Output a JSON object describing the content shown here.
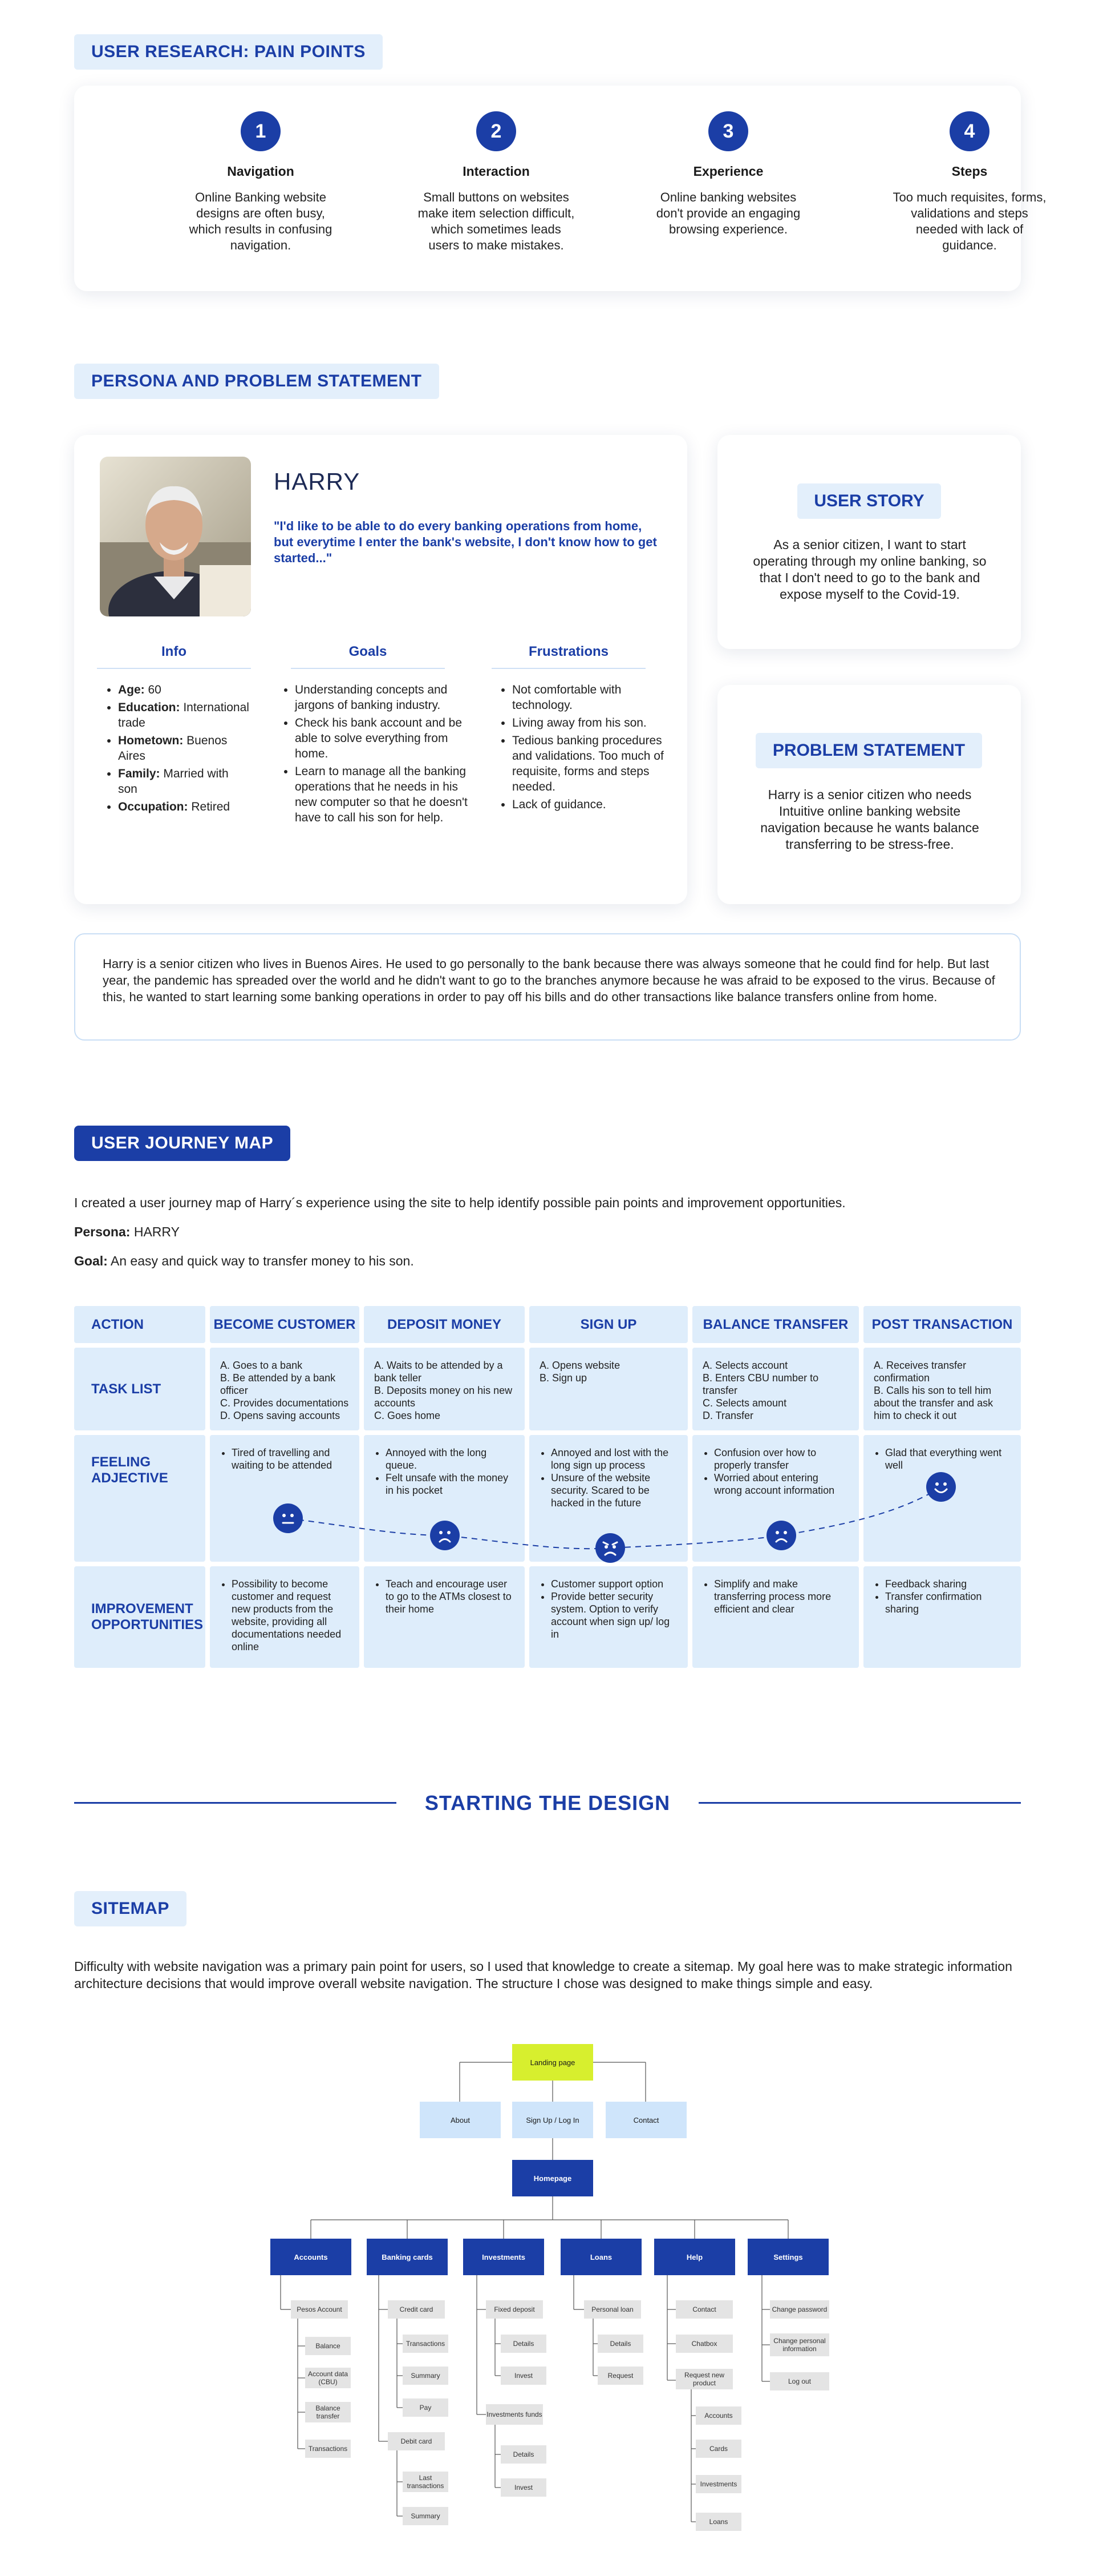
{
  "pain_points": {
    "heading": "USER RESEARCH: PAIN POINTS",
    "items": [
      {
        "num": "1",
        "title": "Navigation",
        "text": "Online Banking website designs are often busy, which results in confusing navigation."
      },
      {
        "num": "2",
        "title": "Interaction",
        "text": "Small buttons on websites make item selection difficult, which sometimes leads users to make mistakes."
      },
      {
        "num": "3",
        "title": "Experience",
        "text": "Online banking websites don't provide an engaging browsing experience."
      },
      {
        "num": "4",
        "title": "Steps",
        "text": "Too much requisites, forms, validations and steps needed with lack of guidance."
      }
    ]
  },
  "persona": {
    "heading": "PERSONA AND PROBLEM STATEMENT",
    "name": "HARRY",
    "quote": "\"I'd like to be able to do every banking operations from home, but everytime I enter the bank's website, I don't know how to get started...\"",
    "info_title": "Info",
    "info": [
      {
        "label": "Age:",
        "value": " 60"
      },
      {
        "label": "Education:",
        "value": " International trade"
      },
      {
        "label": "Hometown:",
        "value": " Buenos Aires"
      },
      {
        "label": "Family:",
        "value": " Married with son"
      },
      {
        "label": "Occupation:",
        "value": " Retired"
      }
    ],
    "goals_title": "Goals",
    "goals": [
      "Understanding concepts and jargons of banking industry.",
      "Check his bank account and be able to solve everything from home.",
      "Learn to manage all the banking operations that he needs in his new computer so that he doesn't have to call his son for help."
    ],
    "frustrations_title": "Frustrations",
    "frustrations": [
      "Not comfortable with technology.",
      "Living away from his son.",
      "Tedious banking procedures and validations. Too much of requisite, forms and steps needed.",
      "Lack of guidance."
    ],
    "user_story_title": "USER STORY",
    "user_story": "As a senior citizen, I want to start operating through my online banking, so that I don't need to go to the bank and expose myself to the Covid-19.",
    "problem_title": "PROBLEM STATEMENT",
    "problem": "Harry is a senior citizen who needs Intuitive online banking website navigation because he wants balance transferring to be stress-free.",
    "summary": "Harry is a senior citizen who lives in Buenos Aires. He used to go personally to the bank because there was always someone that he could find for help. But last year, the pandemic has spreaded over the world and he didn't want to go to the branches anymore because he was afraid to be exposed to the virus. Because of this, he wanted to start learning some banking operations in order to pay off his bills and do other transactions like balance transfers online from home."
  },
  "journey": {
    "heading": "USER JOURNEY MAP",
    "intro": "I created a user journey map of Harry´s experience using the site to help identify possible pain points and improvement opportunities.",
    "persona_label": "Persona:",
    "persona_value": " HARRY",
    "goal_label": "Goal:",
    "goal_value": " An easy and quick way to transfer money to his son.",
    "action_label": "ACTION",
    "columns": [
      "BECOME CUSTOMER",
      "DEPOSIT MONEY",
      "SIGN UP",
      "BALANCE TRANSFER",
      "POST TRANSACTION"
    ],
    "row_labels": [
      "TASK LIST",
      "FEELING ADJECTIVE",
      "IMPROVEMENT OPPORTUNITIES"
    ],
    "tasks": [
      [
        "A. Goes to a bank",
        "B. Be attended by a bank officer",
        "C. Provides documentations",
        "D. Opens saving accounts"
      ],
      [
        "A. Waits to be attended by a bank teller",
        "B. Deposits money on his new accounts",
        "C. Goes home"
      ],
      [
        "A. Opens website",
        "B. Sign up"
      ],
      [
        "A. Selects account",
        "B. Enters CBU number to transfer",
        "C. Selects amount",
        "D. Transfer"
      ],
      [
        "A. Receives transfer confirmation",
        "B. Calls his son to tell him about the transfer and ask him to check it out"
      ]
    ],
    "feelings": [
      [
        "Tired of travelling and waiting to be attended"
      ],
      [
        "Annoyed with the long queue.",
        "Felt unsafe with the money in his pocket"
      ],
      [
        "Annoyed and lost with the long sign up process",
        "Unsure of the website security. Scared to be hacked in the future"
      ],
      [
        "Confusion over how to properly transfer",
        "Worried about entering wrong account information"
      ],
      [
        "Glad that everything went well"
      ]
    ],
    "improvements": [
      [
        "Possibility to become customer and request new products from the website, providing all documentations needed online"
      ],
      [
        "Teach and encourage user to go to the ATMs closest to their home"
      ],
      [
        "Customer support option",
        "Provide better security system. Option to verify account when sign up/ log in"
      ],
      [
        "Simplify and make transferring process more efficient and clear"
      ],
      [
        "Feedback sharing",
        "Transfer confirmation sharing"
      ]
    ]
  },
  "design": {
    "heading": "STARTING THE DESIGN"
  },
  "sitemap": {
    "heading": "SITEMAP",
    "intro": "Difficulty with website navigation was a primary pain point for users, so I used that knowledge to create a sitemap.  My goal here was to make strategic information architecture decisions that would improve overall website navigation. The structure I chose was designed to make things simple and easy.",
    "landing": "Landing page",
    "top": [
      "About",
      "Sign Up / Log In",
      "Contact"
    ],
    "homepage": "Homepage",
    "sections": [
      "Accounts",
      "Banking cards",
      "Investments",
      "Loans",
      "Help",
      "Settings"
    ],
    "accounts": [
      "Pesos Account",
      "Balance",
      "Account data (CBU)",
      "Balance transfer",
      "Transactions"
    ],
    "cards": [
      "Credit card",
      "Transactions",
      "Summary",
      "Pay",
      "Debit card",
      "Last transactions",
      "Summary"
    ],
    "investments": [
      "Fixed deposit",
      "Details",
      "Invest",
      "Investments funds",
      "Details",
      "Invest"
    ],
    "loans": [
      "Personal loan",
      "Details",
      "Request"
    ],
    "help": [
      "Contact",
      "Chatbox",
      "Request new product",
      "Accounts",
      "Cards",
      "Investments",
      "Loans"
    ],
    "settings": [
      "Change password",
      "Change personal information",
      "Log out"
    ]
  }
}
